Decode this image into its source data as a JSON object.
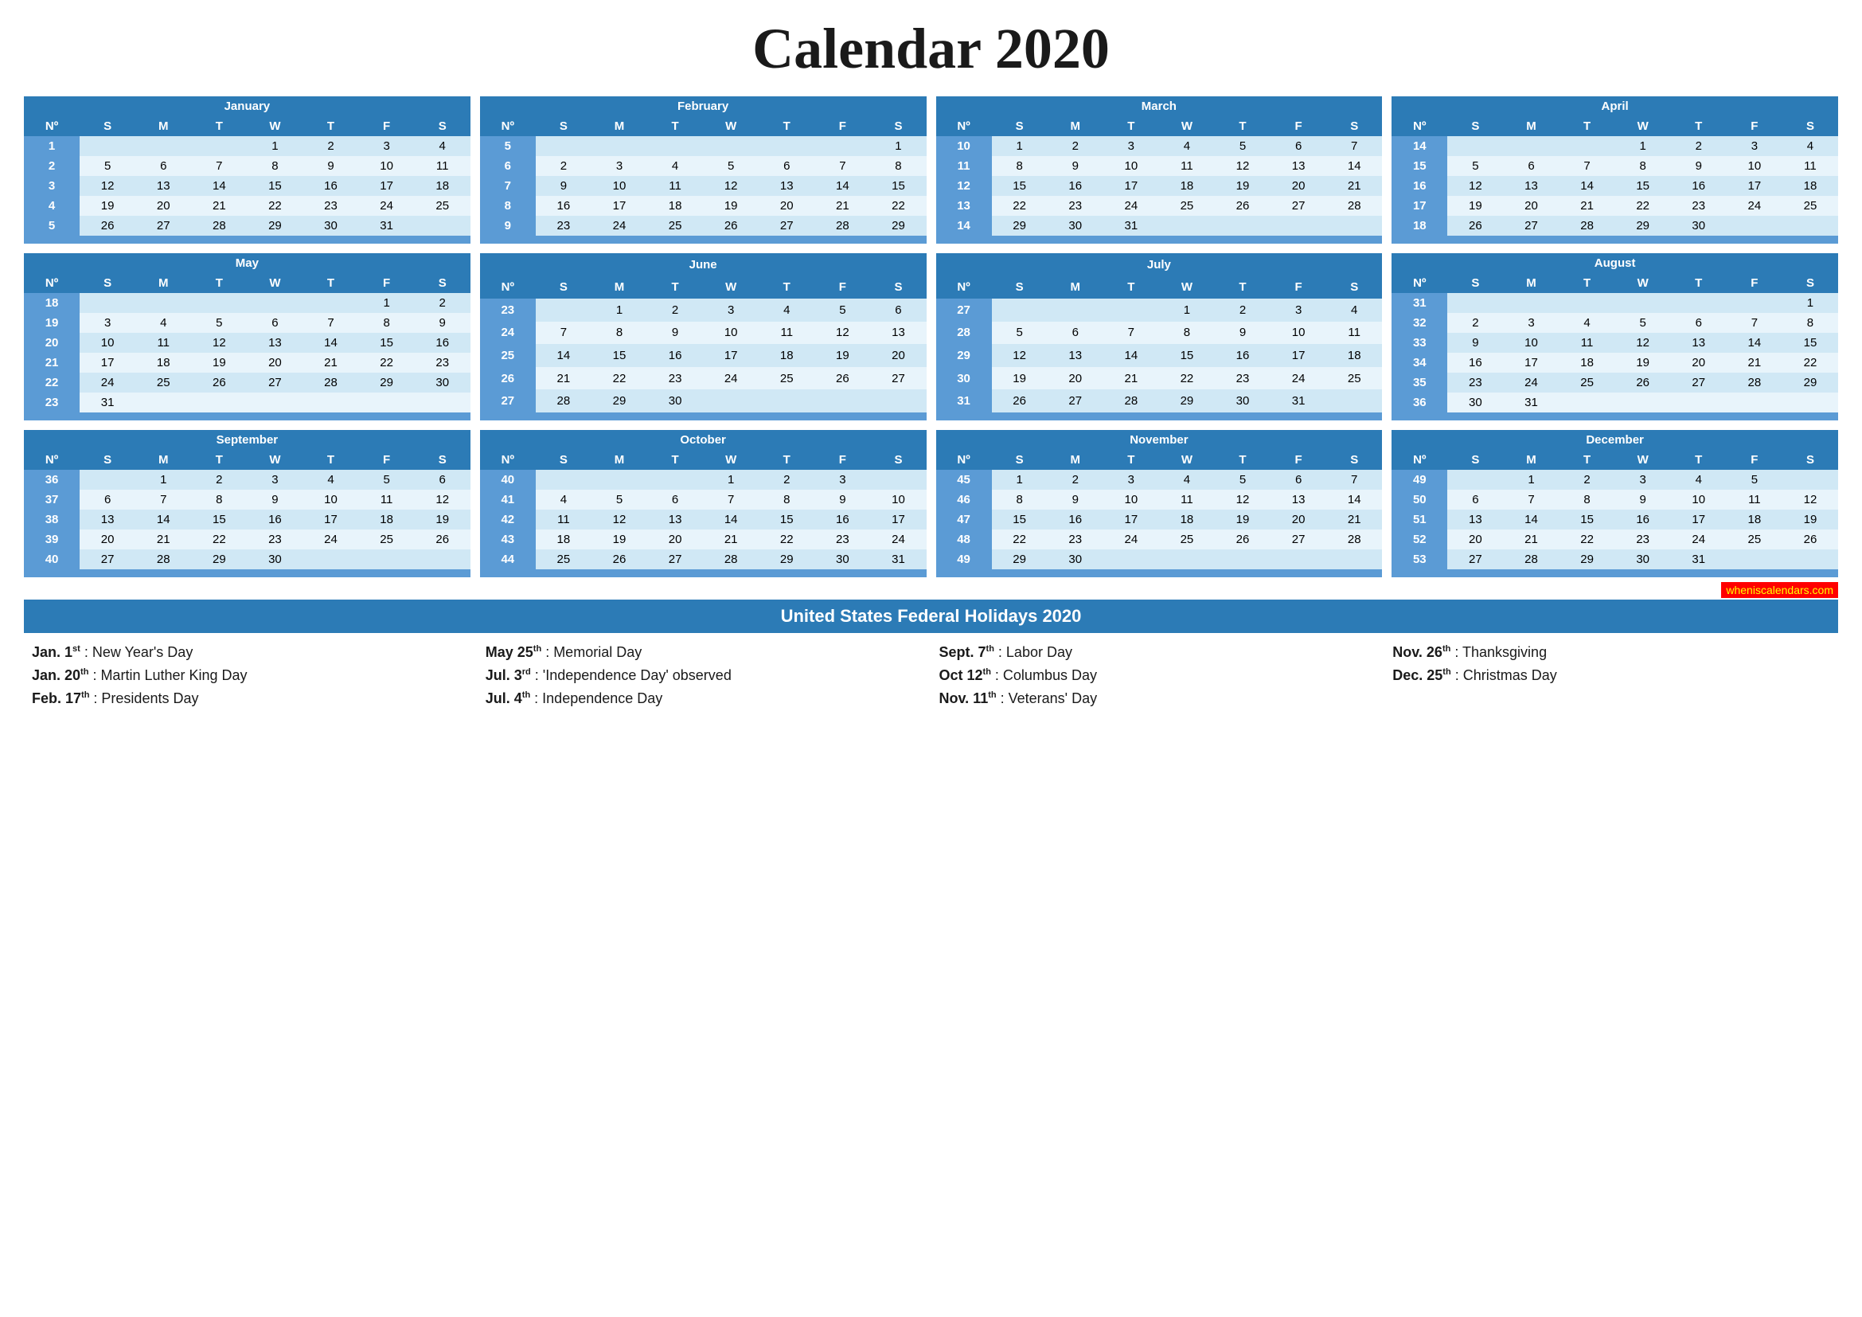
{
  "title": "Calendar 2020",
  "months": [
    {
      "name": "January",
      "weeks": [
        {
          "num": 1,
          "days": [
            "",
            "",
            "",
            "1",
            "2",
            "3",
            "4"
          ]
        },
        {
          "num": 2,
          "days": [
            "5",
            "6",
            "7",
            "8",
            "9",
            "10",
            "11"
          ]
        },
        {
          "num": 3,
          "days": [
            "12",
            "13",
            "14",
            "15",
            "16",
            "17",
            "18"
          ]
        },
        {
          "num": 4,
          "days": [
            "19",
            "20",
            "21",
            "22",
            "23",
            "24",
            "25"
          ]
        },
        {
          "num": 5,
          "days": [
            "26",
            "27",
            "28",
            "29",
            "30",
            "31",
            ""
          ]
        }
      ]
    },
    {
      "name": "February",
      "weeks": [
        {
          "num": 5,
          "days": [
            "",
            "",
            "",
            "",
            "",
            "",
            "1"
          ]
        },
        {
          "num": 6,
          "days": [
            "2",
            "3",
            "4",
            "5",
            "6",
            "7",
            "8"
          ]
        },
        {
          "num": 7,
          "days": [
            "9",
            "10",
            "11",
            "12",
            "13",
            "14",
            "15"
          ]
        },
        {
          "num": 8,
          "days": [
            "16",
            "17",
            "18",
            "19",
            "20",
            "21",
            "22"
          ]
        },
        {
          "num": 9,
          "days": [
            "23",
            "24",
            "25",
            "26",
            "27",
            "28",
            "29"
          ]
        }
      ]
    },
    {
      "name": "March",
      "weeks": [
        {
          "num": 10,
          "days": [
            "1",
            "2",
            "3",
            "4",
            "5",
            "6",
            "7"
          ]
        },
        {
          "num": 11,
          "days": [
            "8",
            "9",
            "10",
            "11",
            "12",
            "13",
            "14"
          ]
        },
        {
          "num": 12,
          "days": [
            "15",
            "16",
            "17",
            "18",
            "19",
            "20",
            "21"
          ]
        },
        {
          "num": 13,
          "days": [
            "22",
            "23",
            "24",
            "25",
            "26",
            "27",
            "28"
          ]
        },
        {
          "num": 14,
          "days": [
            "29",
            "30",
            "31",
            "",
            "",
            "",
            ""
          ]
        }
      ]
    },
    {
      "name": "April",
      "weeks": [
        {
          "num": 14,
          "days": [
            "",
            "",
            "",
            "1",
            "2",
            "3",
            "4"
          ]
        },
        {
          "num": 15,
          "days": [
            "5",
            "6",
            "7",
            "8",
            "9",
            "10",
            "11"
          ]
        },
        {
          "num": 16,
          "days": [
            "12",
            "13",
            "14",
            "15",
            "16",
            "17",
            "18"
          ]
        },
        {
          "num": 17,
          "days": [
            "19",
            "20",
            "21",
            "22",
            "23",
            "24",
            "25"
          ]
        },
        {
          "num": 18,
          "days": [
            "26",
            "27",
            "28",
            "29",
            "30",
            "",
            ""
          ]
        }
      ]
    },
    {
      "name": "May",
      "weeks": [
        {
          "num": 18,
          "days": [
            "",
            "",
            "",
            "",
            "",
            "1",
            "2"
          ]
        },
        {
          "num": 19,
          "days": [
            "3",
            "4",
            "5",
            "6",
            "7",
            "8",
            "9"
          ]
        },
        {
          "num": 20,
          "days": [
            "10",
            "11",
            "12",
            "13",
            "14",
            "15",
            "16"
          ]
        },
        {
          "num": 21,
          "days": [
            "17",
            "18",
            "19",
            "20",
            "21",
            "22",
            "23"
          ]
        },
        {
          "num": 22,
          "days": [
            "24",
            "25",
            "26",
            "27",
            "28",
            "29",
            "30"
          ]
        },
        {
          "num": 23,
          "days": [
            "31",
            "",
            "",
            "",
            "",
            "",
            ""
          ]
        }
      ]
    },
    {
      "name": "June",
      "weeks": [
        {
          "num": 23,
          "days": [
            "",
            "1",
            "2",
            "3",
            "4",
            "5",
            "6"
          ]
        },
        {
          "num": 24,
          "days": [
            "7",
            "8",
            "9",
            "10",
            "11",
            "12",
            "13"
          ]
        },
        {
          "num": 25,
          "days": [
            "14",
            "15",
            "16",
            "17",
            "18",
            "19",
            "20"
          ]
        },
        {
          "num": 26,
          "days": [
            "21",
            "22",
            "23",
            "24",
            "25",
            "26",
            "27"
          ]
        },
        {
          "num": 27,
          "days": [
            "28",
            "29",
            "30",
            "",
            "",
            "",
            ""
          ]
        }
      ]
    },
    {
      "name": "July",
      "weeks": [
        {
          "num": 27,
          "days": [
            "",
            "",
            "",
            "1",
            "2",
            "3",
            "4"
          ]
        },
        {
          "num": 28,
          "days": [
            "5",
            "6",
            "7",
            "8",
            "9",
            "10",
            "11"
          ]
        },
        {
          "num": 29,
          "days": [
            "12",
            "13",
            "14",
            "15",
            "16",
            "17",
            "18"
          ]
        },
        {
          "num": 30,
          "days": [
            "19",
            "20",
            "21",
            "22",
            "23",
            "24",
            "25"
          ]
        },
        {
          "num": 31,
          "days": [
            "26",
            "27",
            "28",
            "29",
            "30",
            "31",
            ""
          ]
        }
      ]
    },
    {
      "name": "August",
      "weeks": [
        {
          "num": 31,
          "days": [
            "",
            "",
            "",
            "",
            "",
            "",
            "1"
          ]
        },
        {
          "num": 32,
          "days": [
            "2",
            "3",
            "4",
            "5",
            "6",
            "7",
            "8"
          ]
        },
        {
          "num": 33,
          "days": [
            "9",
            "10",
            "11",
            "12",
            "13",
            "14",
            "15"
          ]
        },
        {
          "num": 34,
          "days": [
            "16",
            "17",
            "18",
            "19",
            "20",
            "21",
            "22"
          ]
        },
        {
          "num": 35,
          "days": [
            "23",
            "24",
            "25",
            "26",
            "27",
            "28",
            "29"
          ]
        },
        {
          "num": 36,
          "days": [
            "30",
            "31",
            "",
            "",
            "",
            "",
            ""
          ]
        }
      ]
    },
    {
      "name": "September",
      "weeks": [
        {
          "num": 36,
          "days": [
            "",
            "1",
            "2",
            "3",
            "4",
            "5",
            "6"
          ]
        },
        {
          "num": 37,
          "days": [
            "6",
            "7",
            "8",
            "9",
            "10",
            "11",
            "12"
          ]
        },
        {
          "num": 38,
          "days": [
            "13",
            "14",
            "15",
            "16",
            "17",
            "18",
            "19"
          ]
        },
        {
          "num": 39,
          "days": [
            "20",
            "21",
            "22",
            "23",
            "24",
            "25",
            "26"
          ]
        },
        {
          "num": 40,
          "days": [
            "27",
            "28",
            "29",
            "30",
            "",
            "",
            ""
          ]
        }
      ]
    },
    {
      "name": "October",
      "weeks": [
        {
          "num": 40,
          "days": [
            "",
            "",
            "",
            "1",
            "2",
            "3",
            ""
          ]
        },
        {
          "num": 41,
          "days": [
            "4",
            "5",
            "6",
            "7",
            "8",
            "9",
            "10"
          ]
        },
        {
          "num": 42,
          "days": [
            "11",
            "12",
            "13",
            "14",
            "15",
            "16",
            "17"
          ]
        },
        {
          "num": 43,
          "days": [
            "18",
            "19",
            "20",
            "21",
            "22",
            "23",
            "24"
          ]
        },
        {
          "num": 44,
          "days": [
            "25",
            "26",
            "27",
            "28",
            "29",
            "30",
            "31"
          ]
        }
      ]
    },
    {
      "name": "November",
      "weeks": [
        {
          "num": 45,
          "days": [
            "1",
            "2",
            "3",
            "4",
            "5",
            "6",
            "7"
          ]
        },
        {
          "num": 46,
          "days": [
            "8",
            "9",
            "10",
            "11",
            "12",
            "13",
            "14"
          ]
        },
        {
          "num": 47,
          "days": [
            "15",
            "16",
            "17",
            "18",
            "19",
            "20",
            "21"
          ]
        },
        {
          "num": 48,
          "days": [
            "22",
            "23",
            "24",
            "25",
            "26",
            "27",
            "28"
          ]
        },
        {
          "num": 49,
          "days": [
            "29",
            "30",
            "",
            "",
            "",
            "",
            ""
          ]
        }
      ]
    },
    {
      "name": "December",
      "weeks": [
        {
          "num": 49,
          "days": [
            "",
            "1",
            "2",
            "3",
            "4",
            "5",
            ""
          ]
        },
        {
          "num": 50,
          "days": [
            "6",
            "7",
            "8",
            "9",
            "10",
            "11",
            "12"
          ]
        },
        {
          "num": 51,
          "days": [
            "13",
            "14",
            "15",
            "16",
            "17",
            "18",
            "19"
          ]
        },
        {
          "num": 52,
          "days": [
            "20",
            "21",
            "22",
            "23",
            "24",
            "25",
            "26"
          ]
        },
        {
          "num": 53,
          "days": [
            "27",
            "28",
            "29",
            "30",
            "31",
            "",
            ""
          ]
        }
      ]
    }
  ],
  "holidays_title": "United States Federal Holidays 2020",
  "holidays": [
    [
      {
        "date": "Jan. 1",
        "sup": "st",
        "name": "New Year's Day"
      },
      {
        "date": "Jan. 20",
        "sup": "th",
        "name": "Martin Luther King Day"
      },
      {
        "date": "Feb. 17",
        "sup": "th",
        "name": "Presidents Day"
      }
    ],
    [
      {
        "date": "May 25",
        "sup": "th",
        "name": "Memorial Day"
      },
      {
        "date": "Jul. 3",
        "sup": "rd",
        "name": "'Independence Day' observed"
      },
      {
        "date": "Jul. 4",
        "sup": "th",
        "name": "Independence Day"
      }
    ],
    [
      {
        "date": "Sept. 7",
        "sup": "th",
        "name": "Labor Day"
      },
      {
        "date": "Oct 12",
        "sup": "th",
        "name": "Columbus Day"
      },
      {
        "date": "Nov. 11",
        "sup": "th",
        "name": "Veterans' Day"
      }
    ],
    [
      {
        "date": "Nov. 26",
        "sup": "th",
        "name": "Thanksgiving"
      },
      {
        "date": "Dec. 25",
        "sup": "th",
        "name": "Christmas Day"
      },
      {
        "date": "",
        "sup": "",
        "name": ""
      }
    ]
  ],
  "watermark": "wheniscalendars.com",
  "day_headers": [
    "Nº",
    "S",
    "M",
    "T",
    "W",
    "T",
    "F",
    "S"
  ]
}
